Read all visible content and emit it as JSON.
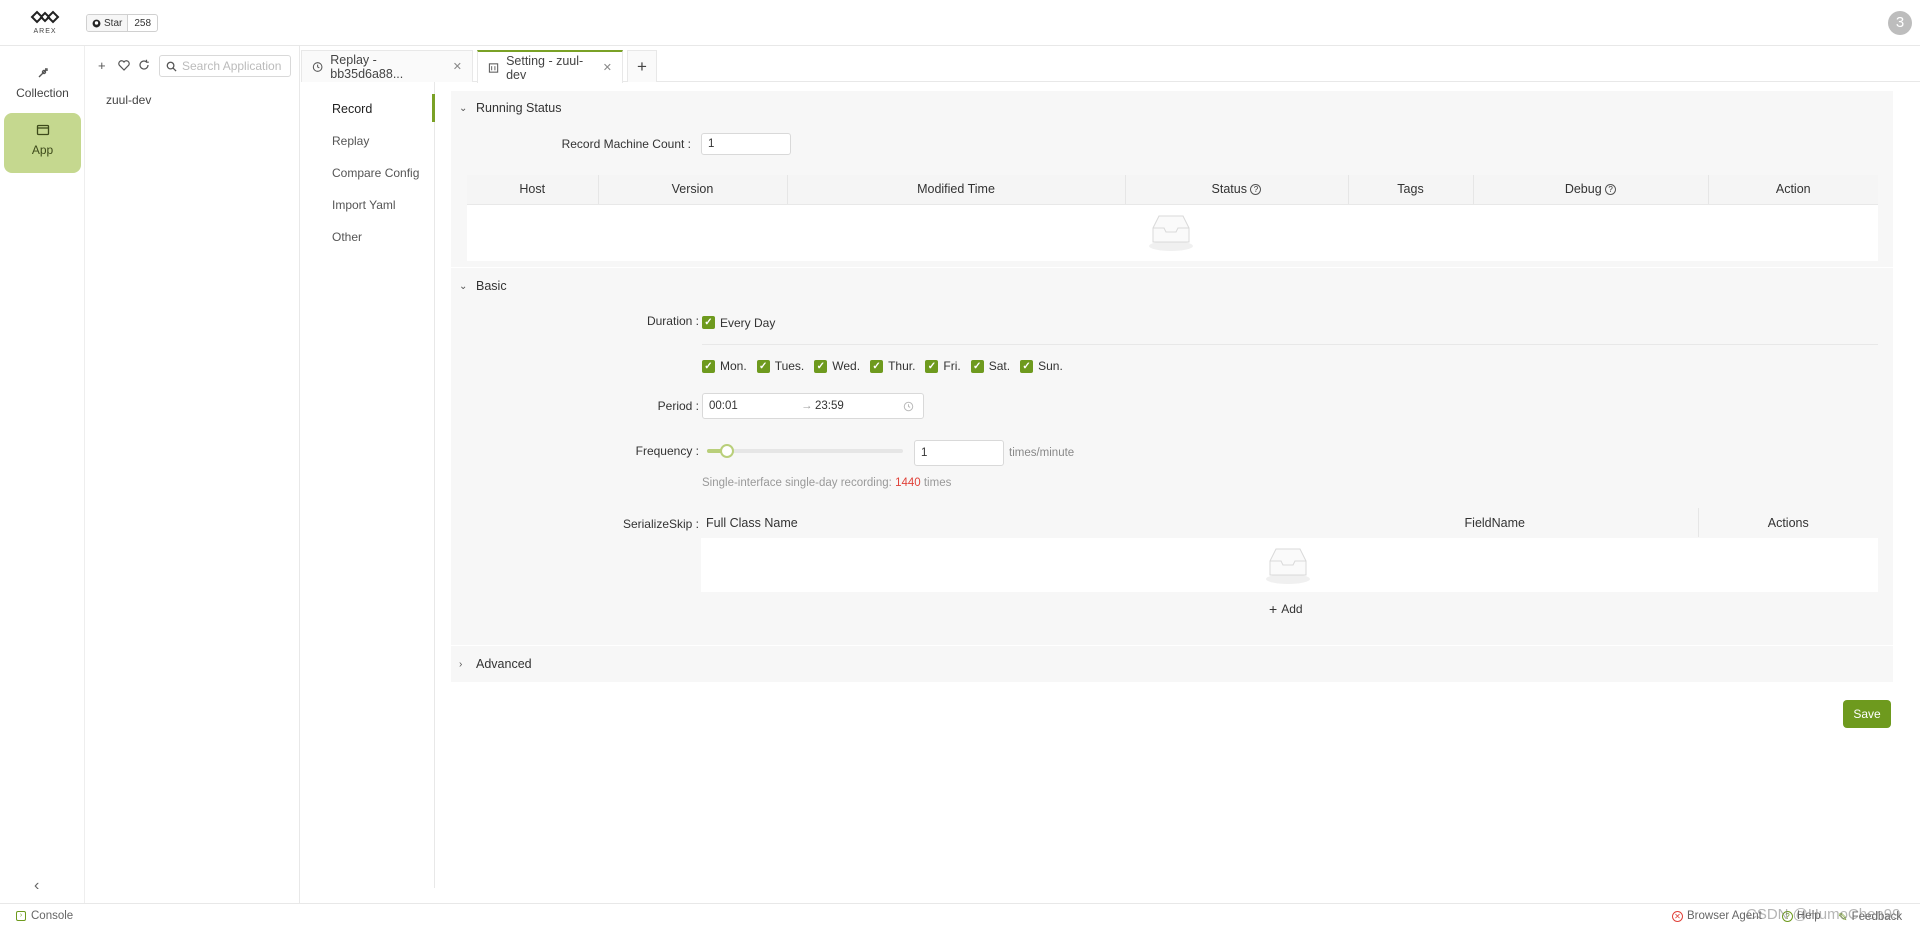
{
  "header": {
    "logo_text": "AREX",
    "star_label": "Star",
    "star_count": "258",
    "avatar_letter": "3"
  },
  "rail": {
    "collection_label": "Collection",
    "app_label": "App"
  },
  "app_panel": {
    "search_placeholder": "Search Application",
    "items": [
      "zuul-dev"
    ]
  },
  "tabs": [
    {
      "label": "Replay - bb35d6a88..."
    },
    {
      "label": "Setting - zuul-dev"
    }
  ],
  "subnav": [
    "Record",
    "Replay",
    "Compare Config",
    "Import Yaml",
    "Other"
  ],
  "running_status": {
    "title": "Running Status",
    "record_machine_count_label": "Record Machine Count :",
    "record_machine_count": "1",
    "columns": [
      "Host",
      "Version",
      "Modified Time",
      "Status",
      "Tags",
      "Debug",
      "Action"
    ]
  },
  "basic": {
    "title": "Basic",
    "duration_label": "Duration :",
    "every_day_label": "Every Day",
    "days": [
      "Mon.",
      "Tues.",
      "Wed.",
      "Thur.",
      "Fri.",
      "Sat.",
      "Sun."
    ],
    "period_label": "Period :",
    "period_start": "00:01",
    "period_end": "23:59",
    "frequency_label": "Frequency :",
    "frequency_value": "1",
    "frequency_unit": "times/minute",
    "frequency_slider_fraction": 0.1,
    "recording_note_prefix": "Single-interface single-day recording:",
    "recording_count": "1440",
    "recording_note_suffix": "times",
    "serialize_skip_label": "SerializeSkip :",
    "skip_columns": [
      "Full Class Name",
      "FieldName",
      "Actions"
    ],
    "add_label": "Add"
  },
  "advanced": {
    "title": "Advanced"
  },
  "save_label": "Save",
  "statusbar": {
    "console": "Console",
    "browser_agent": "Browser Agent",
    "help": "Help",
    "feedback": "Feedback",
    "watermark": "CSDN @HumoChen99"
  },
  "colors": {
    "accent": "#6e9a1e",
    "rail_active": "#c5d88f",
    "highlight_number": "#e0423a"
  }
}
